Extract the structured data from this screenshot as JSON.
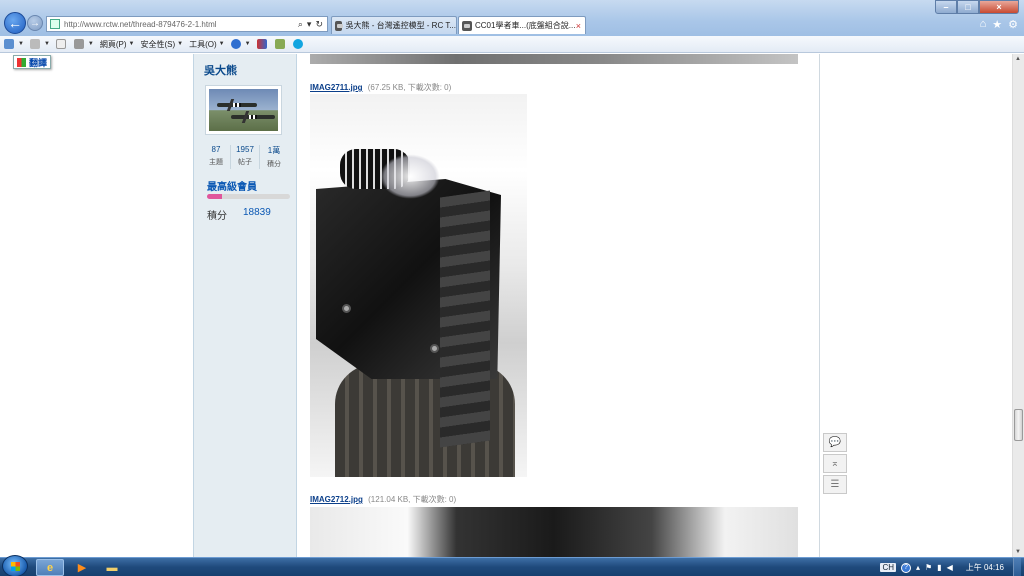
{
  "browser": {
    "url": "http://www.rctw.net/thread-879476-2-1.html",
    "tabs": [
      {
        "label": "吳大熊 - 台灣遙控模型 - RC T..."
      },
      {
        "label": "CC01學者車...(底盤組合說...",
        "close": "×"
      }
    ],
    "window_controls": {
      "minimize": "–",
      "maximize": "□",
      "close": "×"
    },
    "right_icons": [
      "home-icon",
      "star-icon",
      "gear-icon"
    ]
  },
  "command_bar": {
    "items": [
      {
        "label": "網頁(P)"
      },
      {
        "label": "安全性(S)"
      },
      {
        "label": "工具(O)"
      }
    ]
  },
  "translate": {
    "label": "翻譯"
  },
  "post": {
    "author": "吳大熊",
    "stats": [
      {
        "value": "87",
        "label": "主題"
      },
      {
        "value": "1957",
        "label": "帖子"
      },
      {
        "value": "1萬",
        "label": "積分"
      }
    ],
    "rank": "最高級會員",
    "rank_progress": 0.18,
    "points_label": "積分",
    "points_value": "18839"
  },
  "attachments": [
    {
      "filename": "IMAG2711.jpg",
      "meta": "(67.25 KB, 下載次數: 0)"
    },
    {
      "filename": "IMAG2712.jpg",
      "meta": "(121.04 KB, 下載次數: 0)"
    }
  ],
  "side_tools": [
    "comment-icon",
    "back-to-top-icon",
    "list-icon"
  ],
  "taskbar": {
    "clock": "上午 04:16",
    "lang": "CH"
  }
}
